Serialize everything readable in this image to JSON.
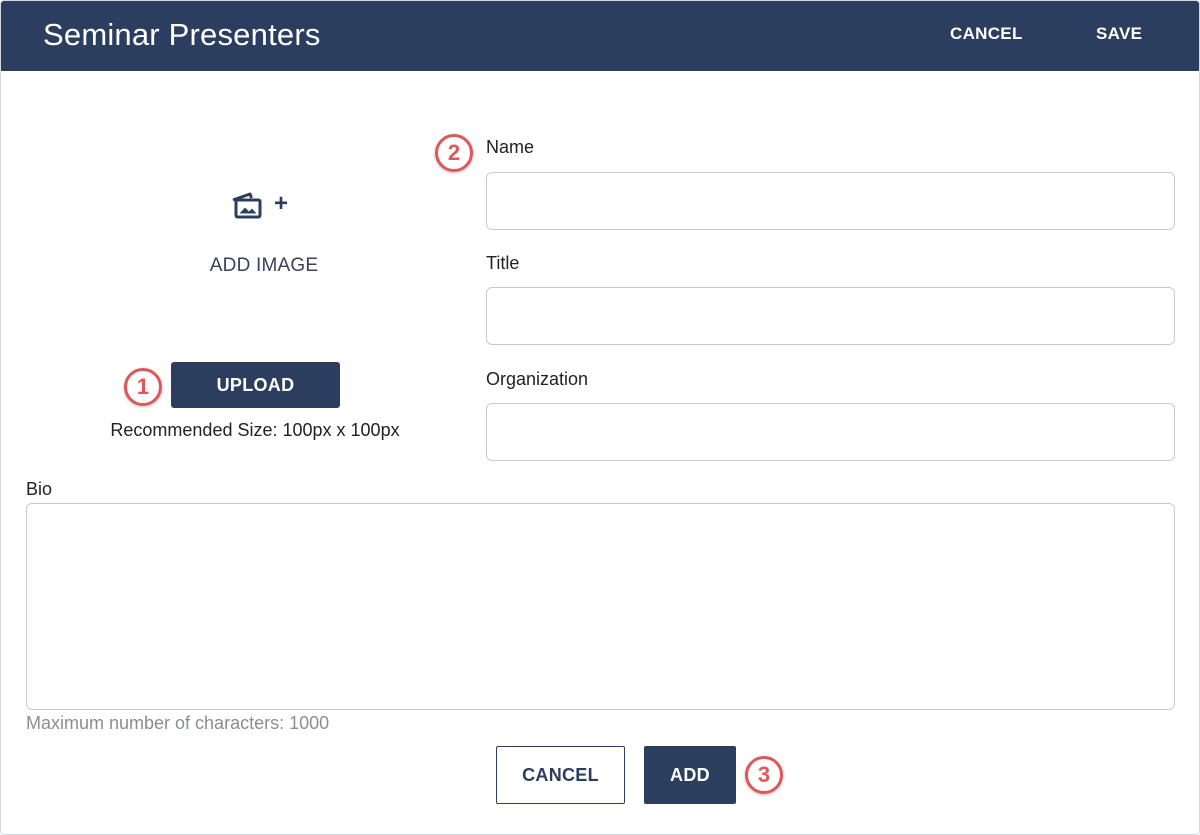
{
  "header": {
    "title": "Seminar Presenters",
    "cancel_label": "CANCEL",
    "save_label": "SAVE",
    "background_color": "#2c3e5f"
  },
  "image_panel": {
    "icon": "add-image-icon",
    "plus": "+",
    "add_image_label": "ADD IMAGE",
    "upload_label": "UPLOAD",
    "recommended_size": "Recommended Size: 100px x 100px"
  },
  "form": {
    "name": {
      "label": "Name",
      "value": "",
      "placeholder": ""
    },
    "title": {
      "label": "Title",
      "value": "",
      "placeholder": ""
    },
    "organization": {
      "label": "Organization",
      "value": "",
      "placeholder": ""
    },
    "bio": {
      "label": "Bio",
      "value": "",
      "placeholder": "",
      "max_chars_text": "Maximum number of characters: 1000"
    }
  },
  "footer": {
    "cancel_label": "CANCEL",
    "add_label": "ADD"
  },
  "callouts": {
    "one": "1",
    "two": "2",
    "three": "3",
    "color": "#e0575a"
  }
}
